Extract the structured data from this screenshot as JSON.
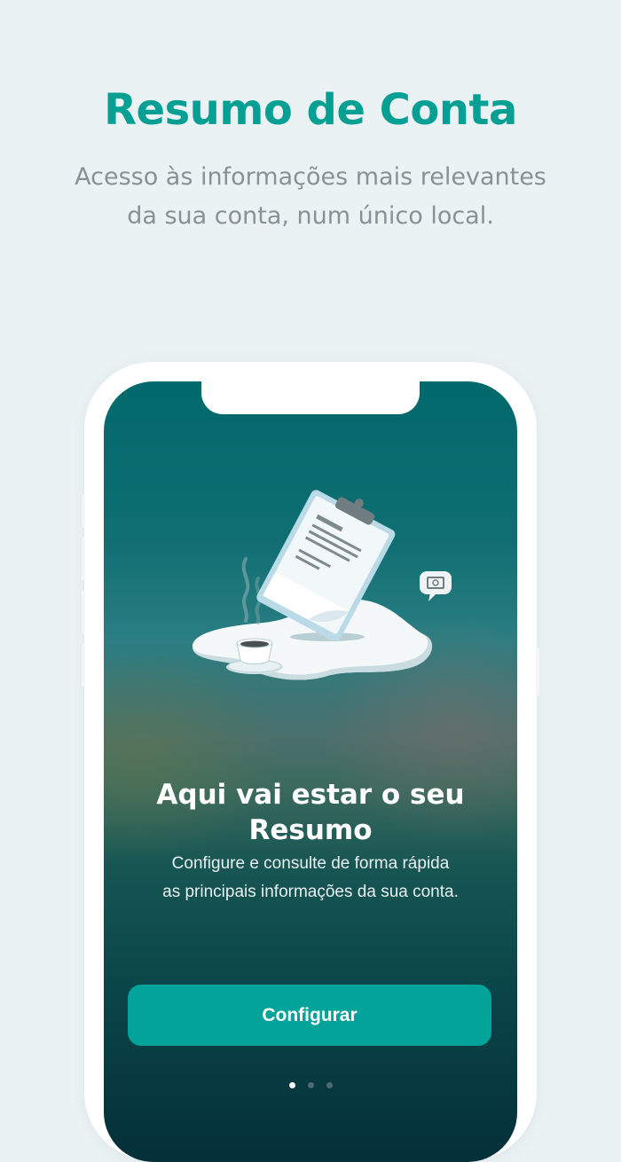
{
  "promo": {
    "title": "Resumo de Conta",
    "subtitle": "Acesso às informações mais relevantes\nda sua conta, num único local.",
    "title_color": "#05a093"
  },
  "screen": {
    "illustration": {
      "description_icons": [
        "clipboard-icon",
        "coffee-cup-icon",
        "money-chat-bubble-icon"
      ]
    },
    "title": "Aqui vai estar o seu\nResumo",
    "text": "Configure e consulte de forma rápida\nas principais informações da sua conta.",
    "button_label": "Configurar",
    "button_color": "#02a398",
    "pagination": {
      "count": 3,
      "active_index": 0
    }
  }
}
